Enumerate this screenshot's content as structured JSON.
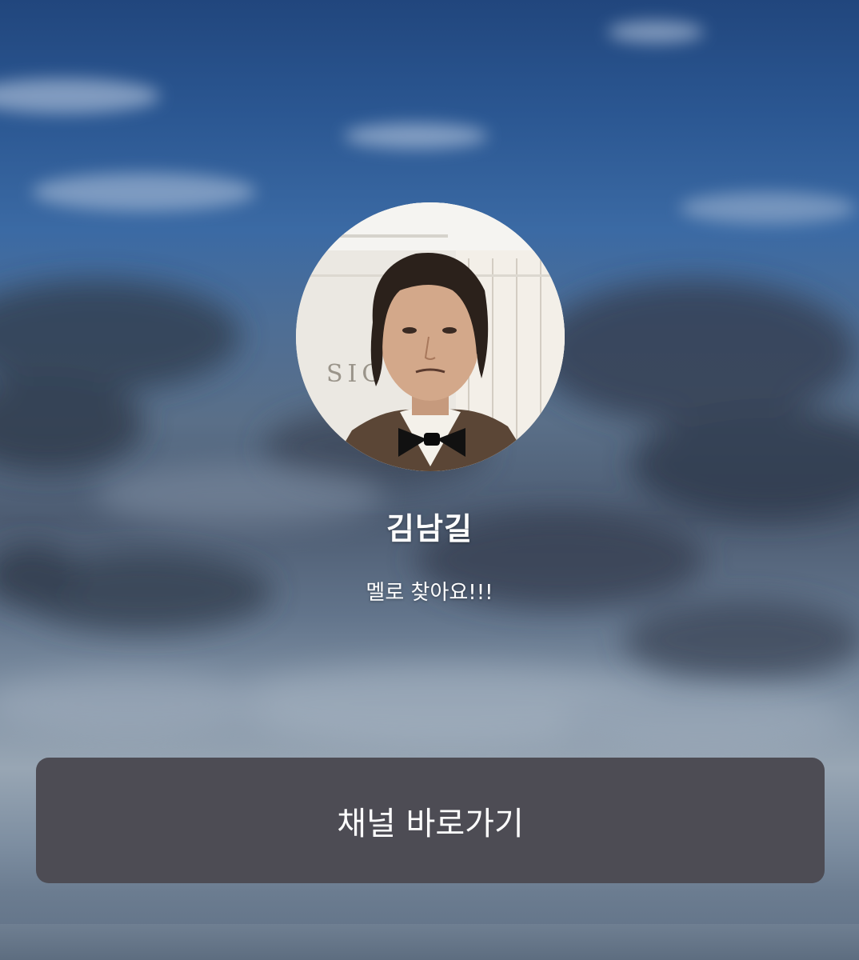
{
  "profile": {
    "name": "김남길",
    "bio": "멜로 찾아요!!!",
    "avatar_sign_text": "SIG"
  },
  "actions": {
    "channel_button_label": "채널 바로가기"
  },
  "colors": {
    "button_background": "#4d4c54",
    "text": "#ffffff",
    "sky_top": "#21467d"
  }
}
